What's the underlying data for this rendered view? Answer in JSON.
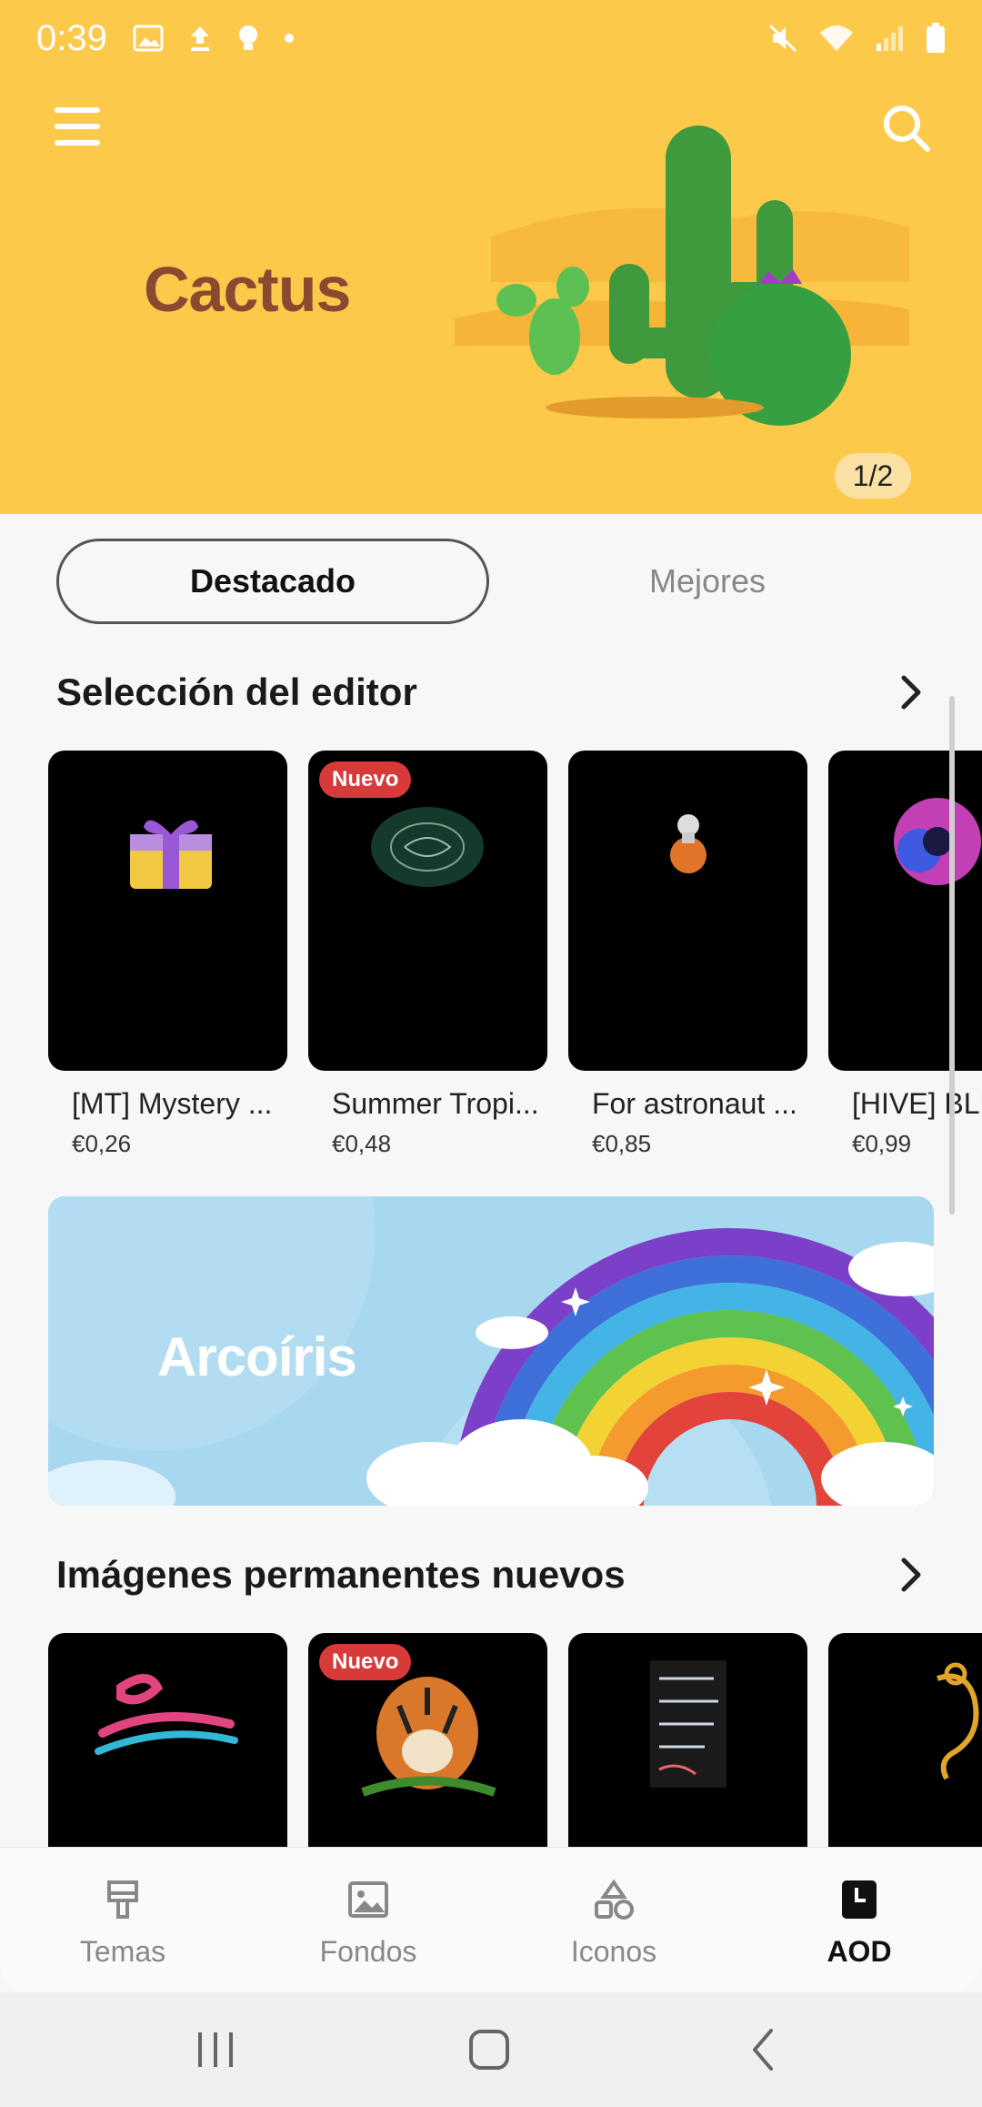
{
  "status": {
    "time": "0:39"
  },
  "hero": {
    "title": "Cactus",
    "pager": "1/2"
  },
  "tabs": [
    {
      "label": "Destacado"
    },
    {
      "label": "Mejores"
    }
  ],
  "sections": {
    "editor": {
      "title": "Selección del editor",
      "items": [
        {
          "name": "[MT] Mystery ...",
          "price": "€0,26",
          "badge": ""
        },
        {
          "name": "Summer Tropi...",
          "price": "€0,48",
          "badge": "Nuevo"
        },
        {
          "name": "For astronaut ...",
          "price": "€0,85",
          "badge": ""
        },
        {
          "name": "[HIVE] BLU",
          "price": "€0,99",
          "badge": ""
        }
      ]
    },
    "banner": {
      "title": "Arcoíris"
    },
    "aod": {
      "title": "Imágenes permanentes nuevos",
      "items": [
        {
          "badge": ""
        },
        {
          "badge": "Nuevo"
        },
        {
          "badge": ""
        },
        {
          "badge": ""
        }
      ]
    }
  },
  "bottom_nav": [
    {
      "label": "Temas",
      "icon": "brush-icon"
    },
    {
      "label": "Fondos",
      "icon": "image-icon"
    },
    {
      "label": "Iconos",
      "icon": "shapes-icon"
    },
    {
      "label": "AOD",
      "icon": "aod-clock-icon"
    }
  ]
}
